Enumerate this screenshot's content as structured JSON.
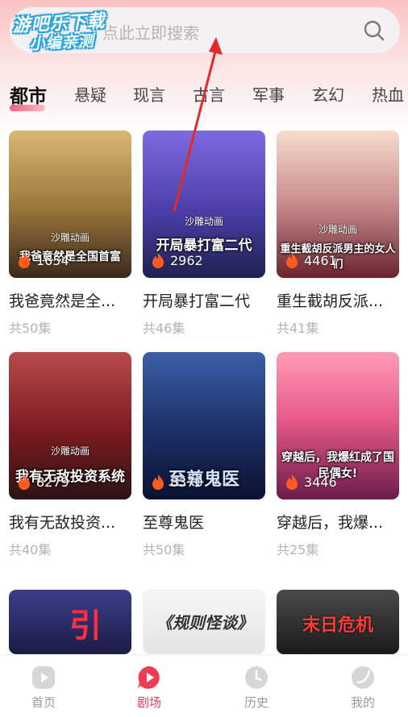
{
  "watermark": {
    "line1": "游吧乐下载",
    "line2": "小编亲测"
  },
  "search": {
    "placeholder": "点此立即搜索"
  },
  "tabs": [
    {
      "label": "都市",
      "active": true
    },
    {
      "label": "悬疑"
    },
    {
      "label": "现言"
    },
    {
      "label": "古言"
    },
    {
      "label": "军事"
    },
    {
      "label": "玄幻"
    },
    {
      "label": "热血"
    }
  ],
  "dramas": [
    {
      "title": "我爸竟然是全...",
      "episodes": "共50集",
      "views": "1654",
      "cover_text": "我爸竟然是全国首富",
      "studio": "沙雕动画",
      "cover_colors": [
        "#c9a86a",
        "#3a2a1c"
      ]
    },
    {
      "title": "开局暴打富二代",
      "episodes": "共46集",
      "views": "2962",
      "cover_text": "开局暴打富二代",
      "studio": "沙雕动画",
      "cover_colors": [
        "#6f5bd6",
        "#2c2a6b"
      ]
    },
    {
      "title": "重生截胡反派...",
      "episodes": "共41集",
      "views": "4461",
      "cover_text": "重生截胡反派男主的女人们",
      "studio": "沙雕动画",
      "cover_colors": [
        "#f2d3c4",
        "#7a2c38"
      ]
    },
    {
      "title": "我有无敌投资...",
      "episodes": "共40集",
      "views": "8279",
      "cover_text": "我有无敌投资系统",
      "studio": "沙雕动画",
      "cover_colors": [
        "#7b1a20",
        "#2a1414"
      ]
    },
    {
      "title": "至尊鬼医",
      "episodes": "共50集",
      "views": "8370",
      "cover_text": "至尊鬼医",
      "studio": "",
      "cover_colors": [
        "#2b4a8c",
        "#0e1736"
      ]
    },
    {
      "title": "穿越后，我爆...",
      "episodes": "共25集",
      "views": "3446",
      "cover_text": "穿越后，我爆红成了国民偶女!",
      "studio": "",
      "cover_colors": [
        "#ff86a8",
        "#6a1d4a"
      ]
    },
    {
      "title": "",
      "episodes": "",
      "views": "",
      "cover_text": "引",
      "studio": "",
      "cover_colors": [
        "#2b2f6e",
        "#0c0d24"
      ]
    },
    {
      "title": "",
      "episodes": "",
      "views": "",
      "cover_text": "《规则怪谈》",
      "studio": "",
      "cover_colors": [
        "#f2f2f2",
        "#dcdcdc"
      ]
    },
    {
      "title": "",
      "episodes": "",
      "views": "",
      "cover_text": "末日危机",
      "studio": "",
      "cover_colors": [
        "#3a3a3a",
        "#1a1a1a"
      ]
    }
  ],
  "bottom_nav": [
    {
      "label": "首页",
      "icon": "play-icon"
    },
    {
      "label": "剧场",
      "icon": "theater-icon",
      "active": true
    },
    {
      "label": "历史",
      "icon": "clock-icon"
    },
    {
      "label": "我的",
      "icon": "profile-icon"
    }
  ],
  "colors": {
    "accent": "#ef3b55",
    "header_gradient_top": "#f9c2c3",
    "annotation_arrow": "#e32929"
  }
}
